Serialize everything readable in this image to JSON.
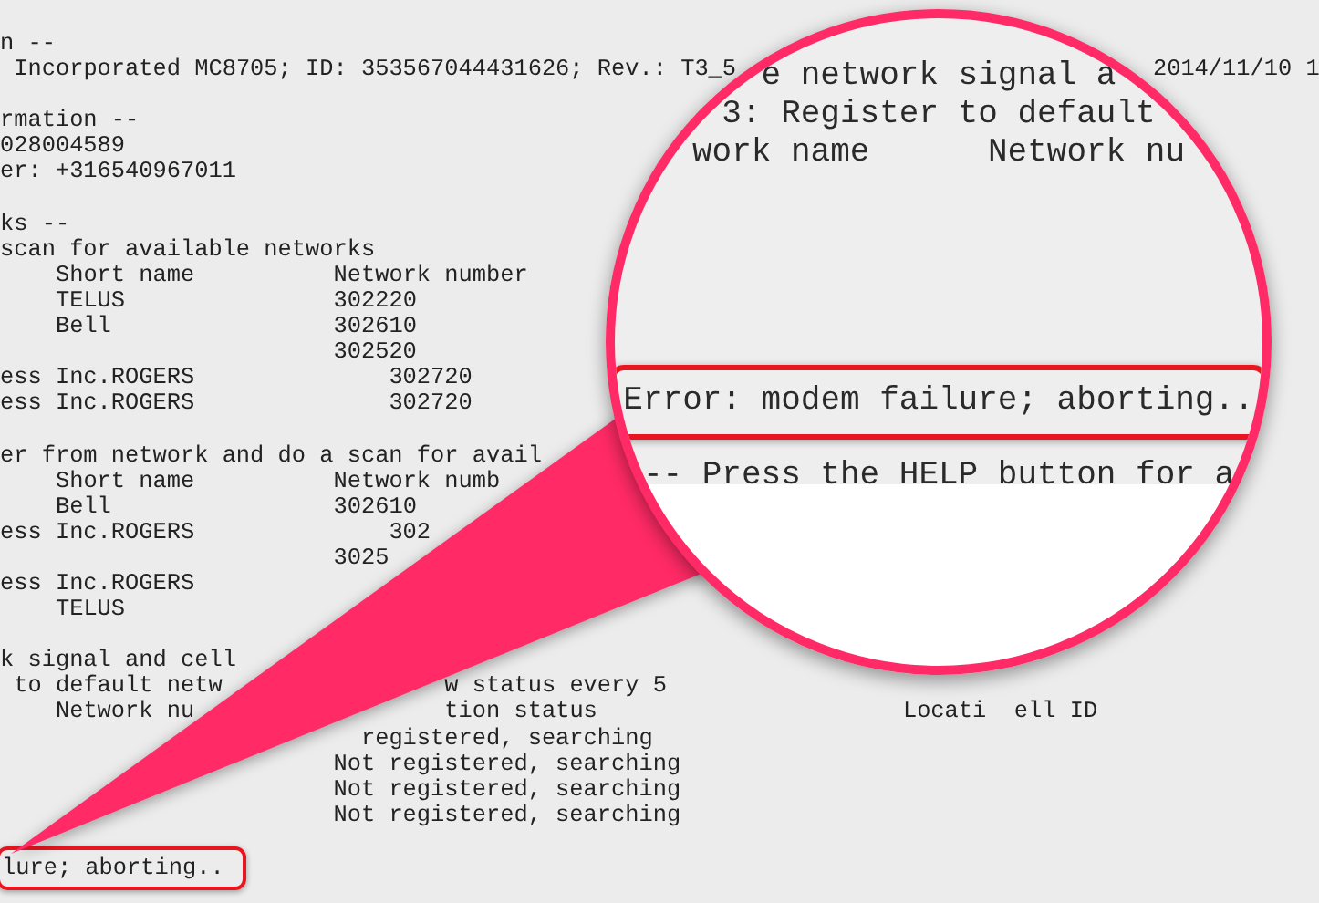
{
  "terminal": {
    "lines": [
      {
        "kind": "text",
        "segments": [
          "n --"
        ],
        "highlighted": false
      },
      {
        "kind": "text",
        "segments": [
          " Incorporated MC8705; ID: 353567044431626; Rev.: T3_5",
          "                              2014/11/10 1"
        ],
        "highlighted": false
      },
      {
        "kind": "blank"
      },
      {
        "kind": "text",
        "segments": [
          "rmation --"
        ],
        "highlighted": false
      },
      {
        "kind": "text",
        "segments": [
          "028004589"
        ],
        "highlighted": false
      },
      {
        "kind": "text",
        "segments": [
          "er: +316540967011"
        ],
        "highlighted": false
      },
      {
        "kind": "blank"
      },
      {
        "kind": "text",
        "segments": [
          "ks --"
        ],
        "highlighted": false
      },
      {
        "kind": "text",
        "segments": [
          "scan for available networks"
        ],
        "highlighted": false
      },
      {
        "kind": "text",
        "segments": [
          "    Short name",
          "          Network number"
        ],
        "highlighted": false
      },
      {
        "kind": "text",
        "segments": [
          "    TELUS",
          "               302220"
        ],
        "highlighted": false
      },
      {
        "kind": "text",
        "segments": [
          "    Bell",
          "                302610"
        ],
        "highlighted": false
      },
      {
        "kind": "text",
        "segments": [
          "                        302520"
        ],
        "highlighted": false
      },
      {
        "kind": "text",
        "segments": [
          "ess Inc.ROGERS",
          "              302720"
        ],
        "highlighted": false
      },
      {
        "kind": "text",
        "segments": [
          "ess Inc.ROGERS",
          "              302720"
        ],
        "highlighted": false
      },
      {
        "kind": "blank"
      },
      {
        "kind": "text",
        "segments": [
          "er from network and do a scan for avail"
        ],
        "highlighted": false
      },
      {
        "kind": "text",
        "segments": [
          "    Short name",
          "          Network numb"
        ],
        "highlighted": false
      },
      {
        "kind": "text",
        "segments": [
          "    Bell",
          "                302610"
        ],
        "highlighted": false
      },
      {
        "kind": "text",
        "segments": [
          "ess Inc.ROGERS",
          "              302"
        ],
        "highlighted": false
      },
      {
        "kind": "text",
        "segments": [
          "                        3025"
        ],
        "highlighted": false
      },
      {
        "kind": "text",
        "segments": [
          "ess Inc.ROGERS"
        ],
        "highlighted": false
      },
      {
        "kind": "text",
        "segments": [
          "    TELUS"
        ],
        "highlighted": false
      },
      {
        "kind": "blank"
      },
      {
        "kind": "text",
        "segments": [
          "k signal and cell"
        ],
        "highlighted": false
      },
      {
        "kind": "text",
        "segments": [
          " to default netw",
          "                w status every 5"
        ],
        "highlighted": false
      },
      {
        "kind": "text",
        "segments": [
          "    Network nu",
          "                  tion status",
          "                      Locati",
          "  ell ID"
        ],
        "highlighted": false
      },
      {
        "kind": "text",
        "segments": [
          "                          registered, searching"
        ],
        "highlighted": false
      },
      {
        "kind": "text",
        "segments": [
          "                        Not registered, searching"
        ],
        "highlighted": false
      },
      {
        "kind": "text",
        "segments": [
          "                        Not registered, searching"
        ],
        "highlighted": false
      },
      {
        "kind": "text",
        "segments": [
          "                        Not registered, searching"
        ],
        "highlighted": false
      },
      {
        "kind": "blank"
      },
      {
        "kind": "text",
        "segments": [
          "lure; aborting.."
        ],
        "highlighted": true
      }
    ]
  },
  "magnifier": {
    "lines": [
      {
        "kind": "text",
        "text": "e network signal a",
        "highlighted": false
      },
      {
        "kind": "text",
        "text": "3: Register to default",
        "highlighted": false
      },
      {
        "kind": "text",
        "text": "work name      Network nu",
        "highlighted": false
      },
      {
        "kind": "blank"
      },
      {
        "kind": "blank"
      },
      {
        "kind": "blank"
      },
      {
        "kind": "blank"
      },
      {
        "kind": "blank"
      },
      {
        "kind": "text",
        "text": "Error: modem failure; aborting..",
        "highlighted": true
      },
      {
        "kind": "text",
        "text": "-- Press the HELP button for a",
        "highlighted": false
      }
    ]
  }
}
